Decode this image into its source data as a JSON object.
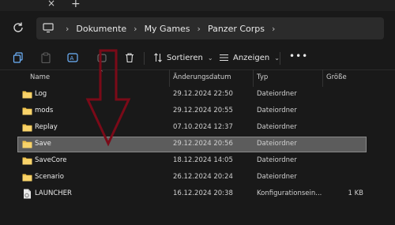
{
  "titlebar": {
    "close_glyph": "×",
    "new_tab_glyph": "+"
  },
  "nav": {
    "breadcrumbs": [
      "Dokumente",
      "My Games",
      "Panzer Corps"
    ],
    "separator": "›"
  },
  "toolbar": {
    "sort_label": "Sortieren",
    "view_label": "Anzeigen",
    "more_label": "•••",
    "dropdown_glyph": "⌄"
  },
  "columns": {
    "name": "Name",
    "modified": "Änderungsdatum",
    "type": "Typ",
    "size": "Größe"
  },
  "files": [
    {
      "name": "Log",
      "modified": "29.12.2024 22:50",
      "type": "Dateiordner",
      "size": "",
      "icon": "folder-icon"
    },
    {
      "name": "mods",
      "modified": "29.12.2024 20:55",
      "type": "Dateiordner",
      "size": "",
      "icon": "folder-icon"
    },
    {
      "name": "Replay",
      "modified": "07.10.2024 12:37",
      "type": "Dateiordner",
      "size": "",
      "icon": "folder-icon"
    },
    {
      "name": "Save",
      "modified": "29.12.2024 20:56",
      "type": "Dateiordner",
      "size": "",
      "icon": "folder-icon",
      "selected": true
    },
    {
      "name": "SaveCore",
      "modified": "18.12.2024 14:05",
      "type": "Dateiordner",
      "size": "",
      "icon": "folder-icon"
    },
    {
      "name": "Scenario",
      "modified": "26.12.2024 20:24",
      "type": "Dateiordner",
      "size": "",
      "icon": "folder-icon"
    },
    {
      "name": "LAUNCHER",
      "modified": "16.12.2024 20:38",
      "type": "Konfigurationsein...",
      "size": "1 KB",
      "icon": "config-file-icon"
    }
  ],
  "colors": {
    "background": "#191919",
    "selection": "#5c5c5c",
    "folder": "#f0c24b",
    "toolbar_accent": "#6fb4ff",
    "annotation_arrow": "#7a0a18"
  }
}
